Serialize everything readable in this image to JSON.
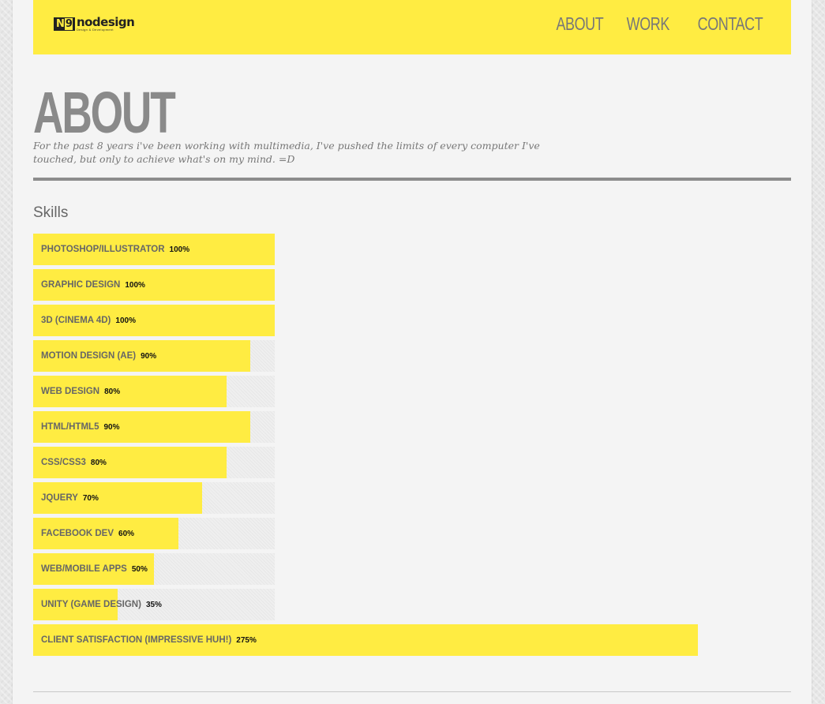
{
  "header": {
    "logo": {
      "mark": "N",
      "mark_number": "9",
      "word": "nodesign",
      "tagline": "Design & Development"
    },
    "nav": [
      {
        "label": "ABOUT"
      },
      {
        "label": "WORK"
      },
      {
        "label": "CONTACT"
      }
    ]
  },
  "main": {
    "title": "ABOUT",
    "intro": "For the past 8 years i've been working with multimedia, I've pushed the limits of every computer I've touched, but only to achieve what's on my mind. =D",
    "skills_heading": "Skills",
    "skills": [
      {
        "label": "PHOTOSHOP/ILLUSTRATOR",
        "percent_text": "100%",
        "percent": 100
      },
      {
        "label": "GRAPHIC DESIGN",
        "percent_text": "100%",
        "percent": 100
      },
      {
        "label": "3D (CINEMA 4D)",
        "percent_text": "100%",
        "percent": 100
      },
      {
        "label": "MOTION DESIGN (AE)",
        "percent_text": "90%",
        "percent": 90
      },
      {
        "label": "WEB DESIGN",
        "percent_text": "80%",
        "percent": 80
      },
      {
        "label": "HTML/HTML5",
        "percent_text": "90%",
        "percent": 90
      },
      {
        "label": "CSS/CSS3",
        "percent_text": "80%",
        "percent": 80
      },
      {
        "label": "JQUERY",
        "percent_text": "70%",
        "percent": 70
      },
      {
        "label": "FACEBOOK DEV",
        "percent_text": "60%",
        "percent": 60
      },
      {
        "label": "WEB/MOBILE APPS",
        "percent_text": "50%",
        "percent": 50
      },
      {
        "label": "UNITY (GAME DESIGN)",
        "percent_text": "35%",
        "percent": 35
      },
      {
        "label": "CLIENT SATISFACTION (IMPRESSIVE HUH!)",
        "percent_text": "275%",
        "percent": 275
      }
    ]
  },
  "colors": {
    "accent": "#ffec42",
    "title_gray": "#8a8a8a",
    "text_gray": "#666666"
  }
}
